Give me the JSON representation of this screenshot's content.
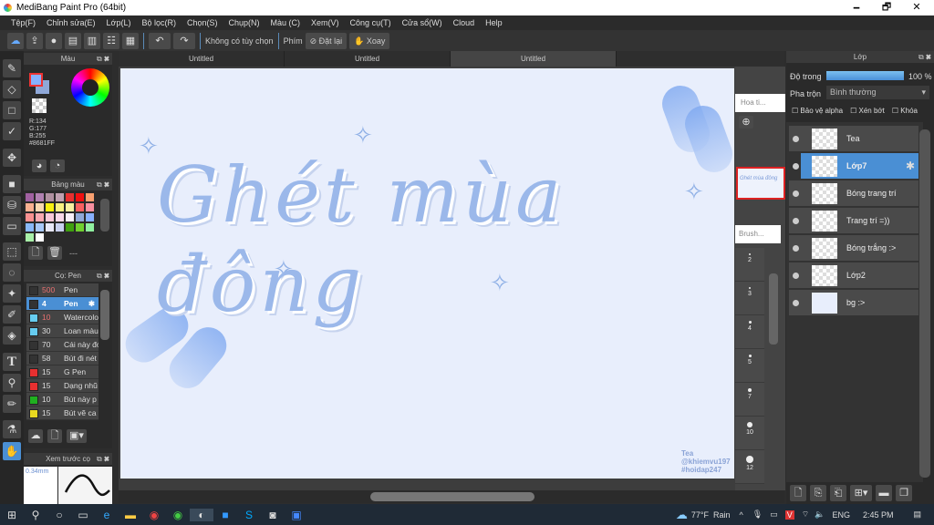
{
  "window": {
    "title": "MediBang Paint Pro (64bit)",
    "minimize": "🗕",
    "maximize": "🗗",
    "close": "✕"
  },
  "menu": [
    "Tệp(F)",
    "Chỉnh sửa(E)",
    "Lớp(L)",
    "Bộ lọc(R)",
    "Chọn(S)",
    "Chụp(N)",
    "Màu (C)",
    "Xem(V)",
    "Công cụ(T)",
    "Cửa sổ(W)",
    "Cloud",
    "Help"
  ],
  "toolbar": {
    "no_option": "Không có tùy chọn",
    "key_label": "Phím",
    "reset": "Đặt lại",
    "rotate": "Xoay"
  },
  "tabs": [
    "Untitled",
    "Untitled",
    "Untitled"
  ],
  "color_panel": {
    "title": "Màu",
    "r": "R:134",
    "g": "G:177",
    "b": "B:255",
    "hex": "#8681FF",
    "fg": "#86b1ff",
    "bg": "#8fa8d8"
  },
  "palette_panel": {
    "title": "Bảng màu",
    "colors": [
      "#a060a0",
      "#b080b0",
      "#b090a0",
      "#c0a0b0",
      "#e83030",
      "#f01010",
      "#f8a070",
      "#f8b090",
      "#f8d8b0",
      "#f8f010",
      "#f8f080",
      "#f8f0a0",
      "#f86060",
      "#f890a0",
      "#f89090",
      "#f8a8b0",
      "#f8c8d8",
      "#f8d8e8",
      "#f8f0f8",
      "#90a8d8",
      "#88b0ff",
      "#88b8f8",
      "#a8c8f8",
      "#e8e8f8",
      "#c8d0f0",
      "#40a010",
      "#70d030",
      "#90f0a0",
      "#a8f0a8",
      "#ffffff"
    ],
    "name": "---"
  },
  "brush_panel": {
    "title": "Cọ: Pen",
    "brushes": [
      {
        "size": "500",
        "name": "Pen",
        "color": "#333333"
      },
      {
        "size": "4",
        "name": "Pen",
        "color": "#333333",
        "selected": true
      },
      {
        "size": "10",
        "name": "Watercolor",
        "color": "#66ccf0"
      },
      {
        "size": "30",
        "name": "Loan màu",
        "color": "#66ccf0"
      },
      {
        "size": "70",
        "name": "Cái này đó",
        "color": "#333333"
      },
      {
        "size": "58",
        "name": "Bút đi nét",
        "color": "#333333"
      },
      {
        "size": "15",
        "name": "G Pen",
        "color": "#e83030"
      },
      {
        "size": "15",
        "name": "Dạng nhũ",
        "color": "#e83030"
      },
      {
        "size": "10",
        "name": "Bút này p",
        "color": "#20b020"
      },
      {
        "size": "15",
        "name": "Bút vẽ ca",
        "color": "#e8d820"
      }
    ]
  },
  "preview_panel": {
    "title": "Xem trước cọ",
    "size": "0.34mm"
  },
  "canvas": {
    "artwork_text": "Ghét mùa đông",
    "signature": [
      "Tea",
      "@khiemvu197",
      "#hoidap247"
    ]
  },
  "navigator": {
    "hoa_ti": "Hoa ti...",
    "brush": "Brush...",
    "sizes": [
      "2",
      "3",
      "4",
      "5",
      "7",
      "10",
      "12"
    ]
  },
  "layer_panel": {
    "title": "Lớp",
    "opacity_label": "Độ trong",
    "opacity": "100 %",
    "opacity_value": 100,
    "blend_label": "Pha trộn",
    "blend": "Bình thường",
    "protect_alpha": "Bảo vệ alpha",
    "clip": "Xén bớt",
    "lock": "Khóa",
    "layers": [
      {
        "name": "Tea"
      },
      {
        "name": "Lớp7",
        "selected": true
      },
      {
        "name": "Bóng trang trí"
      },
      {
        "name": "Trang trí =))"
      },
      {
        "name": "Bóng trắng :>"
      },
      {
        "name": "Lớp2"
      },
      {
        "name": "bg :>"
      }
    ]
  },
  "taskbar": {
    "weather": "77°F",
    "condition": "Rain",
    "lang": "ENG",
    "time": "2:45 PM"
  }
}
